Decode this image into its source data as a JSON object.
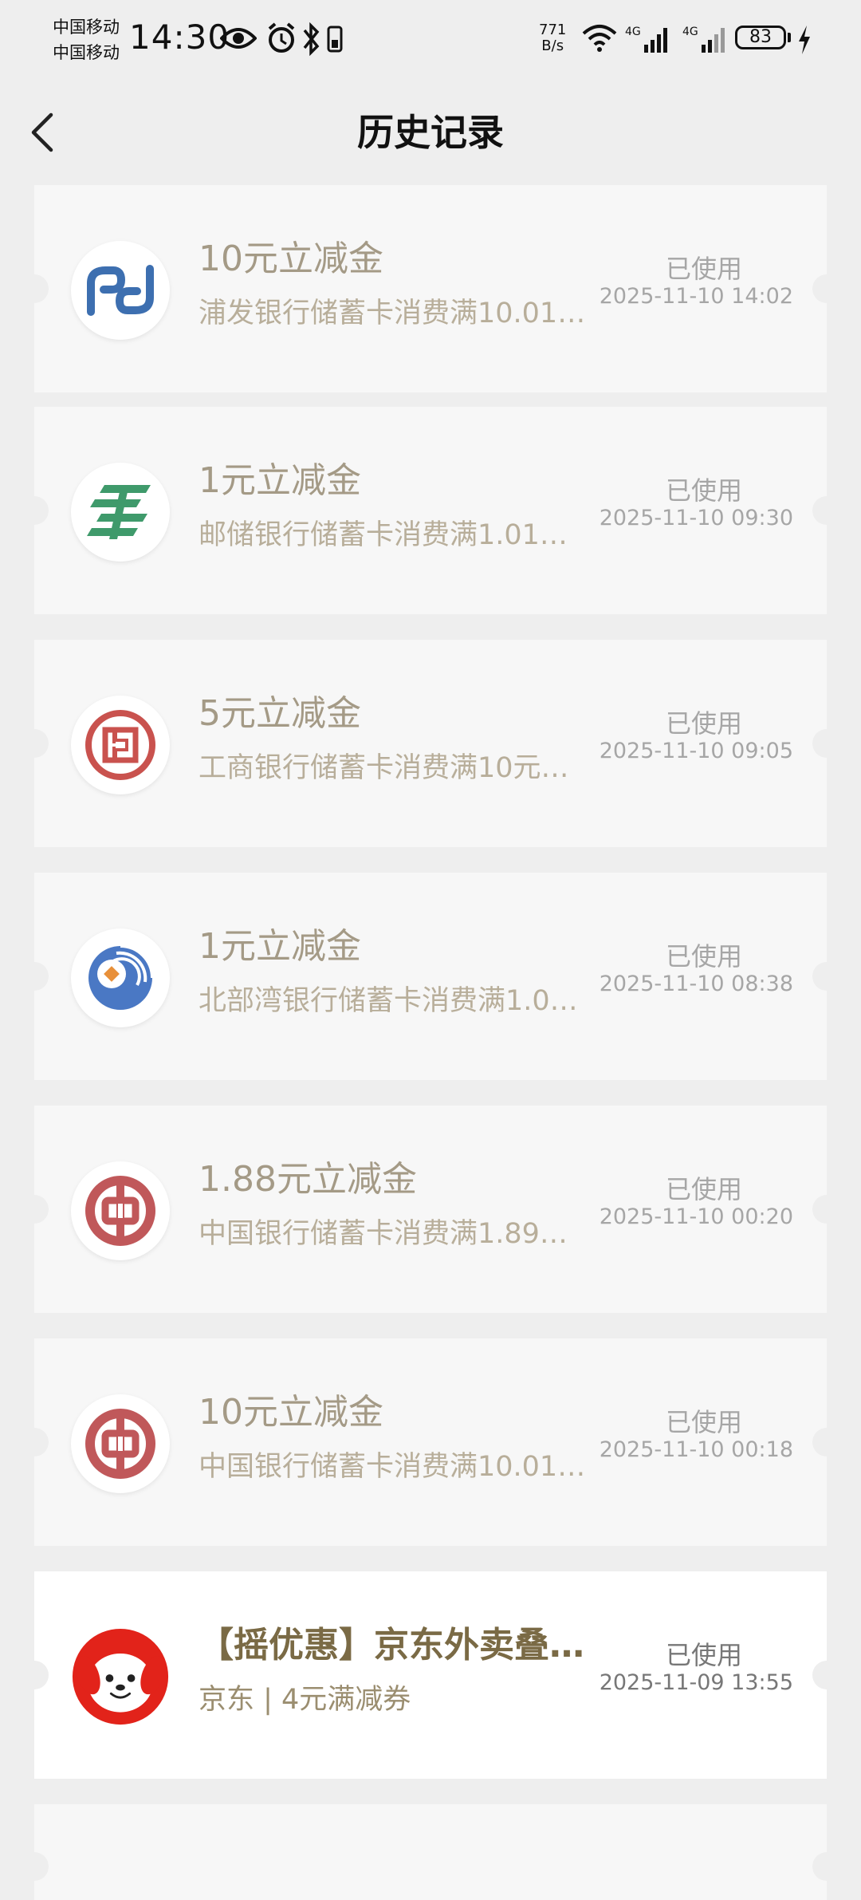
{
  "status_bar": {
    "carrier_1": "中国移动",
    "carrier_2": "中国移动",
    "time": "14:30",
    "net_speed_value": "771",
    "net_speed_unit": "B/s",
    "battery": "83"
  },
  "header": {
    "title": "历史记录"
  },
  "records": [
    {
      "logo": "spdb-logo-icon",
      "title": "10元立减金",
      "subtitle": "浦发银行储蓄卡消费满10.01…",
      "status": "已使用",
      "time": "2025-11-10 14:02"
    },
    {
      "logo": "psbc-logo-icon",
      "title": "1元立减金",
      "subtitle": "邮储银行储蓄卡消费满1.01…",
      "status": "已使用",
      "time": "2025-11-10 09:30"
    },
    {
      "logo": "icbc-logo-icon",
      "title": "5元立减金",
      "subtitle": "工商银行储蓄卡消费满10元…",
      "status": "已使用",
      "time": "2025-11-10 09:05"
    },
    {
      "logo": "beibuwan-bank-logo-icon",
      "title": "1元立减金",
      "subtitle": "北部湾银行储蓄卡消费满1.0…",
      "status": "已使用",
      "time": "2025-11-10 08:38"
    },
    {
      "logo": "boc-logo-icon",
      "title": "1.88元立减金",
      "subtitle": "中国银行储蓄卡消费满1.89…",
      "status": "已使用",
      "time": "2025-11-10 00:20"
    },
    {
      "logo": "boc-logo-icon",
      "title": "10元立减金",
      "subtitle": "中国银行储蓄卡消费满10.01…",
      "status": "已使用",
      "time": "2025-11-10 00:18"
    },
    {
      "logo": "jd-dog-logo-icon",
      "title": "【摇优惠】京东外卖叠…",
      "subtitle": "京东 | 4元满减券",
      "status": "已使用",
      "time": "2025-11-09 13:55"
    }
  ],
  "colors": {
    "background": "#eeeeee",
    "card_used": "#f7f7f7",
    "card_active": "#ffffff",
    "title_gold": "#a49a86",
    "active_title": "#7a6a45",
    "boc_red": "#c0585a",
    "icbc_red": "#c9524e",
    "psbc_green": "#3f9a6b",
    "spdb_blue": "#3d6fb0",
    "jd_red": "#e2231a"
  }
}
